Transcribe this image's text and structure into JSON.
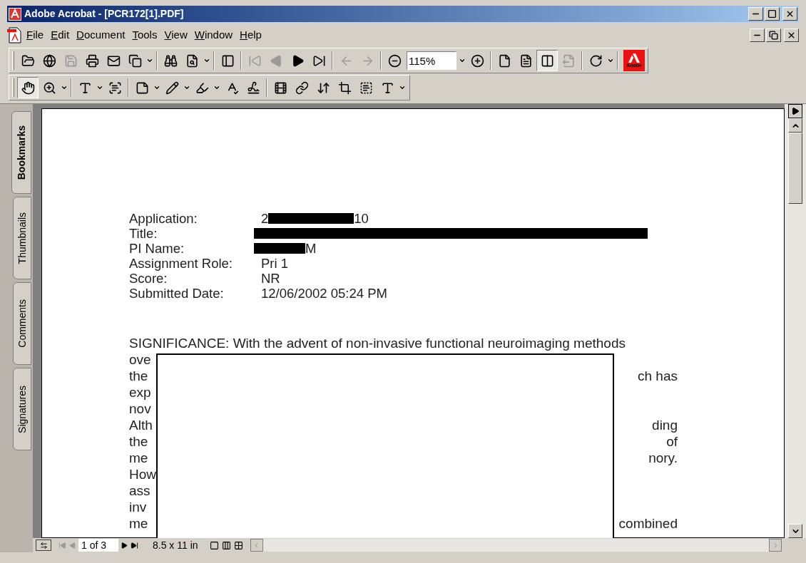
{
  "window": {
    "title": "Adobe Acrobat - [PCR172[1].PDF]"
  },
  "menu": [
    {
      "label": "File"
    },
    {
      "label": "Edit"
    },
    {
      "label": "Document"
    },
    {
      "label": "Tools"
    },
    {
      "label": "View"
    },
    {
      "label": "Window"
    },
    {
      "label": "Help"
    }
  ],
  "toolbars": [
    [
      {
        "kind": "open"
      },
      {
        "kind": "open-web"
      },
      {
        "kind": "save",
        "disabled": true
      },
      {
        "kind": "print"
      },
      {
        "kind": "email"
      },
      {
        "kind": "web-capture"
      },
      {
        "kind": "caret"
      },
      {
        "kind": "separator"
      },
      {
        "kind": "find"
      },
      {
        "kind": "search"
      },
      {
        "kind": "caret"
      },
      {
        "kind": "separator"
      },
      {
        "kind": "nav-pane"
      },
      {
        "kind": "separator"
      },
      {
        "kind": "first-page",
        "disabled": true
      },
      {
        "kind": "prev-page",
        "disabled": true
      },
      {
        "kind": "next-page"
      },
      {
        "kind": "last-page"
      },
      {
        "kind": "separator"
      },
      {
        "kind": "back",
        "disabled": true
      },
      {
        "kind": "forward",
        "disabled": true
      },
      {
        "kind": "separator"
      },
      {
        "kind": "zoom-out"
      },
      {
        "kind": "zoom-field",
        "value": "115%"
      },
      {
        "kind": "caret"
      },
      {
        "kind": "zoom-in"
      },
      {
        "kind": "separator"
      },
      {
        "kind": "actual-size",
        "selected": false
      },
      {
        "kind": "fit-page",
        "selected": false
      },
      {
        "kind": "fit-width",
        "selected": true
      },
      {
        "kind": "reflow",
        "selected": false,
        "disabled": true
      },
      {
        "kind": "separator"
      },
      {
        "kind": "rotate"
      },
      {
        "kind": "caret"
      },
      {
        "kind": "separator"
      },
      {
        "kind": "logo",
        "text": "Adobe"
      }
    ],
    [
      {
        "kind": "hand",
        "selected": true
      },
      {
        "kind": "zoom-tool",
        "selected": false
      },
      {
        "kind": "caret"
      },
      {
        "kind": "separator"
      },
      {
        "kind": "text-select",
        "selected": false
      },
      {
        "kind": "caret"
      },
      {
        "kind": "graphics-select",
        "selected": false
      },
      {
        "kind": "separator"
      },
      {
        "kind": "note"
      },
      {
        "kind": "caret"
      },
      {
        "kind": "pencil"
      },
      {
        "kind": "caret"
      },
      {
        "kind": "highlighter"
      },
      {
        "kind": "caret"
      },
      {
        "kind": "spell-check"
      },
      {
        "kind": "sign"
      },
      {
        "kind": "separator"
      },
      {
        "kind": "movie"
      },
      {
        "kind": "link"
      },
      {
        "kind": "article"
      },
      {
        "kind": "crop"
      },
      {
        "kind": "form"
      },
      {
        "kind": "touchup-text"
      },
      {
        "kind": "caret"
      }
    ]
  ],
  "side_tabs": [
    {
      "label": "Bookmarks",
      "selected": true
    },
    {
      "label": "Thumbnails",
      "selected": false
    },
    {
      "label": "Comments",
      "selected": false
    },
    {
      "label": "Signatures",
      "selected": false
    }
  ],
  "document": {
    "fields": [
      {
        "label": "Application:",
        "value": [
          {
            "kind": "text",
            "text": "2"
          },
          {
            "kind": "redaction"
          },
          {
            "kind": "text",
            "text": "10"
          }
        ]
      },
      {
        "label": "Title:",
        "value": [
          {
            "kind": "long-redaction"
          }
        ]
      },
      {
        "label": "PI Name:",
        "value": [
          {
            "kind": "short-redaction"
          },
          {
            "kind": "text",
            "text": "M"
          }
        ]
      },
      {
        "label": "Assignment Role:",
        "value": [
          {
            "kind": "text",
            "text": "Pri 1"
          }
        ]
      },
      {
        "label": "Score:",
        "value": [
          {
            "kind": "text",
            "text": "NR"
          }
        ]
      },
      {
        "label": "Submitted Date:",
        "value": [
          {
            "kind": "text",
            "text": "12/06/2002 05:24 PM"
          }
        ]
      }
    ],
    "heading_line": "SIGNIFICANCE: With the advent of non-invasive functional neuroimaging methods",
    "covered_lines": [
      {
        "left": "ove"
      },
      {
        "left": "the",
        "right": "ch has"
      },
      {
        "left": "exp"
      },
      {
        "left": "nov"
      },
      {
        "left": "Alth",
        "right": "ding"
      },
      {
        "left": "the",
        "right": "of"
      },
      {
        "left": "me",
        "right": "nory."
      },
      {
        "left": "How"
      },
      {
        "left": "ass"
      },
      {
        "left": "inv"
      },
      {
        "left": "me",
        "right": "combined"
      }
    ]
  },
  "status_bar": {
    "page": "1 of 3",
    "page_size": "8.5 x 11 in"
  }
}
